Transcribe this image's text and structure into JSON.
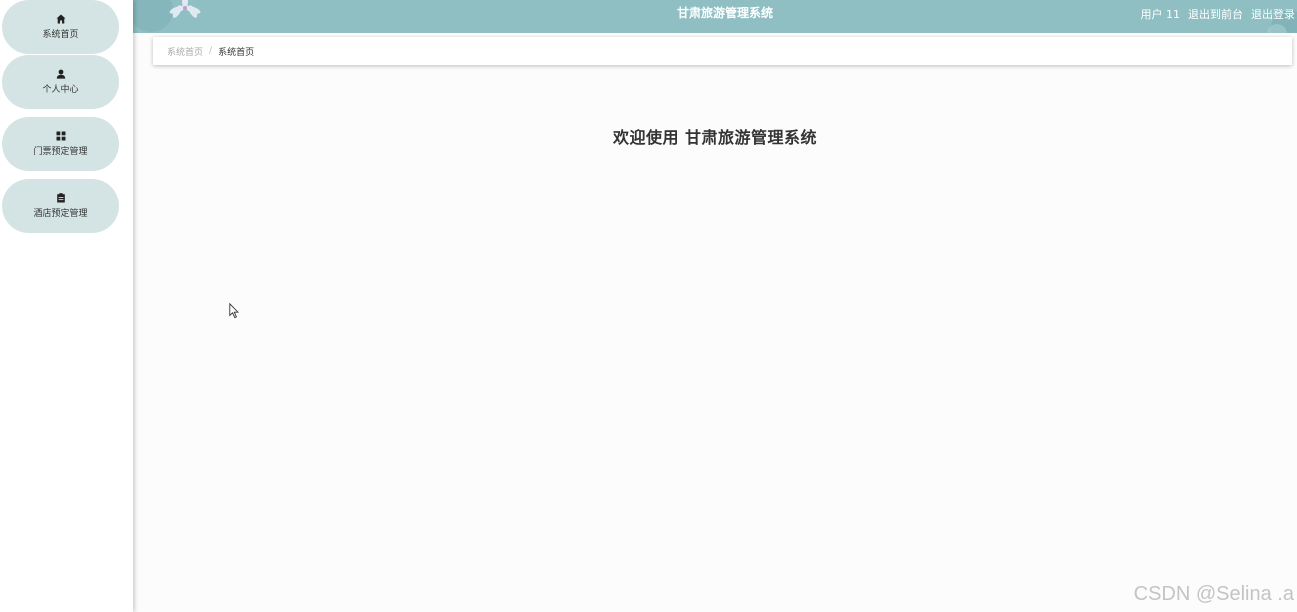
{
  "sidebar": {
    "items": [
      {
        "label": "系统首页",
        "icon": "home-icon"
      },
      {
        "label": "个人中心",
        "icon": "user-icon"
      },
      {
        "label": "门票预定管理",
        "icon": "grid-icon"
      },
      {
        "label": "酒店预定管理",
        "icon": "clipboard-icon"
      }
    ]
  },
  "header": {
    "title": "甘肃旅游管理系统",
    "user": "用户 11",
    "back_to_front": "退出到前台",
    "logout": "退出登录"
  },
  "breadcrumb": {
    "home": "系统首页",
    "separator": "/",
    "current": "系统首页"
  },
  "main": {
    "welcome": "欢迎使用 甘肃旅游管理系统"
  },
  "watermark": "CSDN @Selina .a",
  "colors": {
    "header_bg": "#8fbfc3",
    "menu_item_bg": "#d4e4e4",
    "page_bg": "#fcfcfc"
  }
}
